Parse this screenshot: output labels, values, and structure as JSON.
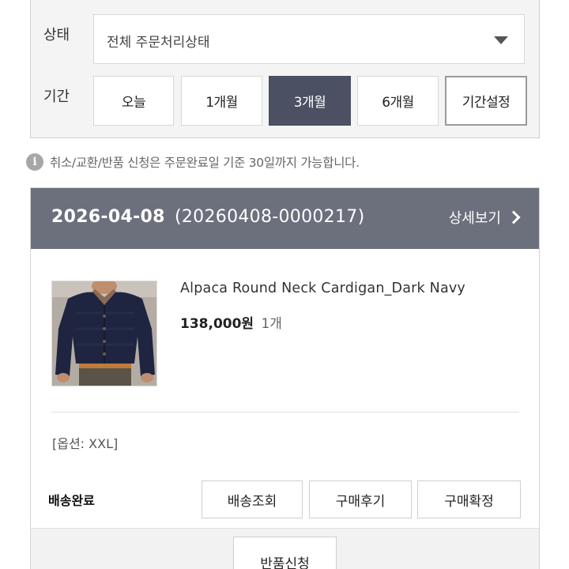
{
  "filter": {
    "status_label": "상태",
    "status_value": "전체 주문처리상태",
    "period_label": "기간",
    "period_options": [
      "오늘",
      "1개월",
      "3개월",
      "6개월",
      "기간설정"
    ],
    "period_selected": "3개월"
  },
  "notice": {
    "icon": "info-icon",
    "text": "취소/교환/반품 신청은 주문완료일 기준 30일까지 가능합니다."
  },
  "order": {
    "date": "2026-04-08",
    "order_number": "(20260408-0000217)",
    "detail_label": "상세보기",
    "product": {
      "name": "Alpaca Round Neck Cardigan_Dark Navy",
      "price": "138,000원",
      "quantity": "1개",
      "option": "[옵션: XXL]"
    },
    "delivery_status": "배송완료",
    "actions": [
      "배송조회",
      "구매후기",
      "구매확정"
    ],
    "return_label": "반품신청"
  },
  "colors": {
    "active_period_bg": "#4b5063",
    "order_header_bg": "#6c707c",
    "product_cardigan": "#1f2540"
  }
}
